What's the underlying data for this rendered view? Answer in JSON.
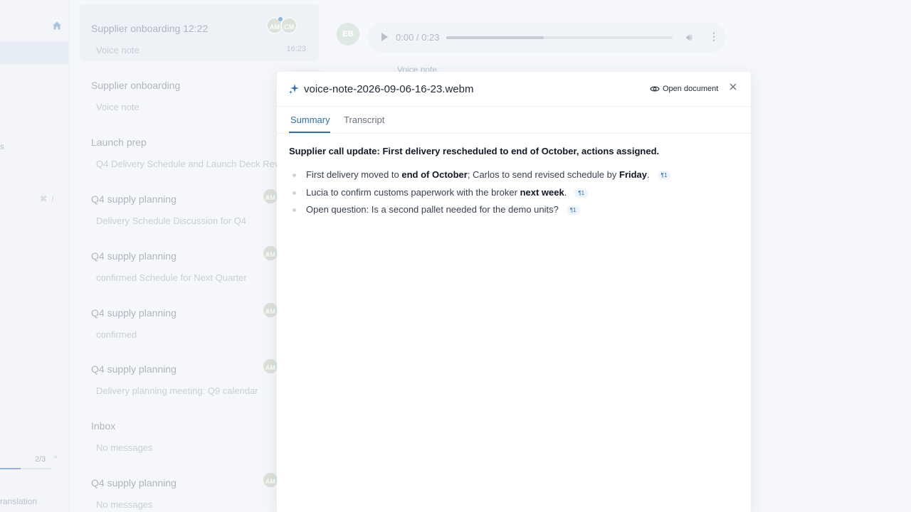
{
  "sidebar": {
    "section_fragment": "s",
    "shortcut": "⌘ /",
    "pager": "2/3",
    "pager_progress": 0.4,
    "translation_fragment": "ranslation"
  },
  "conversations": [
    {
      "title": "Supplier onboarding 12:22",
      "preview": "Voice note",
      "time": "16:23",
      "avatars": [
        "AM",
        "CM"
      ],
      "selected": true
    },
    {
      "title": "Supplier onboarding",
      "preview": "Voice note"
    },
    {
      "title": "Launch prep",
      "preview": "Q4 Delivery Schedule and Launch Deck Revi..."
    },
    {
      "title": "Q4 supply planning",
      "preview": "Delivery Schedule Discussion for Q4",
      "avatars": [
        "AM"
      ]
    },
    {
      "title": "Q4 supply planning",
      "preview": "confirmed Schedule for Next Quarter",
      "avatars": [
        "AM"
      ]
    },
    {
      "title": "Q4 supply planning",
      "preview": "confirmed",
      "avatars": [
        "AM"
      ]
    },
    {
      "title": "Q4 supply planning",
      "preview": "Delivery planning meeting: Q9 calendar",
      "avatars": [
        "AM"
      ]
    },
    {
      "title": "Inbox",
      "preview": "No messages"
    },
    {
      "title": "Q4 supply planning",
      "preview": "No messages",
      "avatars": [
        "AM"
      ]
    }
  ],
  "chat": {
    "sender_initials": "EB",
    "audio_time": "0:00 / 0:23",
    "audio_progress": 0.43,
    "voice_note_label": "Voice note"
  },
  "modal": {
    "title": "voice-note-2026-09-06-16-23.webm",
    "open_document": "Open document",
    "tabs": {
      "summary": "Summary",
      "transcript": "Transcript"
    },
    "summary_heading": "Supplier call update: First delivery rescheduled to end of October, actions assigned.",
    "bullets": [
      [
        {
          "t": "First delivery moved to "
        },
        {
          "t": "end of October",
          "b": true
        },
        {
          "t": "; Carlos to send revised schedule by "
        },
        {
          "t": "Friday",
          "b": true
        },
        {
          "t": "."
        }
      ],
      [
        {
          "t": "Lucia to confirm customs paperwork with the broker "
        },
        {
          "t": "next week",
          "b": true
        },
        {
          "t": "."
        }
      ],
      [
        {
          "t": "Open question: Is a second pallet needed for the demo units?"
        }
      ]
    ],
    "ref_label": "¶1"
  },
  "colors": {
    "accent": "#2f6fb3",
    "avatar_green": "#d9e3d8"
  },
  "icons": [
    "home-icon",
    "sparkle-icon",
    "eye-icon",
    "close-icon",
    "play-icon",
    "volume-icon",
    "more-vertical-icon"
  ]
}
